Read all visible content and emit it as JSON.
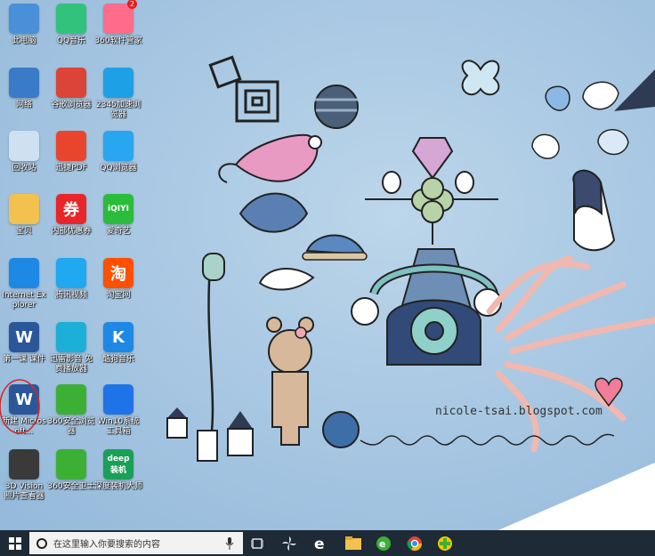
{
  "desktop": {
    "icons": [
      {
        "label": "此电脑",
        "icon": "computer-icon",
        "color": "#4a90d9"
      },
      {
        "label": "QQ音乐",
        "icon": "qq-music-icon",
        "color": "#31c27c"
      },
      {
        "label": "360软件管家",
        "icon": "360-software-manager-icon",
        "color": "#ff6b8a",
        "badge": "2"
      },
      {
        "label": "网络",
        "icon": "network-icon",
        "color": "#3a7bc8"
      },
      {
        "label": "谷歌浏览器",
        "icon": "chrome-icon",
        "color": "#db4437"
      },
      {
        "label": "2345加速浏览器",
        "icon": "ie-browser-icon",
        "color": "#1ea0e6"
      },
      {
        "label": "回收站",
        "icon": "recycle-bin-icon",
        "color": "#cfe0f0"
      },
      {
        "label": "迅捷PDF",
        "icon": "pdf-icon",
        "color": "#e8452c"
      },
      {
        "label": "QQ浏览器",
        "icon": "qq-browser-icon",
        "color": "#2aa5f0"
      },
      {
        "label": "宝贝",
        "icon": "folder-icon",
        "color": "#f2c14e"
      },
      {
        "label": "内部优惠券",
        "icon": "coupon-icon",
        "color": "#e8262a",
        "glyph": "券"
      },
      {
        "label": "爱奇艺",
        "icon": "iqiyi-icon",
        "color": "#2bbc3c",
        "glyph": "iQIYI"
      },
      {
        "label": "Internet Explorer",
        "icon": "internet-explorer-icon",
        "color": "#1e88e5"
      },
      {
        "label": "腾讯视频",
        "icon": "tencent-video-icon",
        "color": "#20a8f0"
      },
      {
        "label": "淘宝网",
        "icon": "taobao-icon",
        "color": "#ff5000",
        "glyph": "淘"
      },
      {
        "label": "第一课 课件",
        "icon": "word-document-icon",
        "color": "#2b579a",
        "glyph": "W"
      },
      {
        "label": "迅雷影音 免费播放器",
        "icon": "thunder-player-icon",
        "color": "#1cb0d8"
      },
      {
        "label": "酷狗音乐",
        "icon": "kugou-icon",
        "color": "#1e88e5",
        "glyph": "K"
      },
      {
        "label": "新建 Microsoft...",
        "icon": "word-document-icon",
        "color": "#2b579a",
        "glyph": "W"
      },
      {
        "label": "360安全浏览器",
        "icon": "360-browser-icon",
        "color": "#3cb035"
      },
      {
        "label": "Win10系统 工具箱",
        "icon": "windows-icon",
        "color": "#1e73e8"
      },
      {
        "label": "3D Vision 照片查看器",
        "icon": "3d-vision-icon",
        "color": "#3a3a3a"
      },
      {
        "label": "360安全卫士",
        "icon": "360-security-icon",
        "color": "#3cb035"
      },
      {
        "label": "深度装机大师",
        "icon": "deepin-install-icon",
        "color": "#18a058",
        "glyph": "deep装机"
      }
    ],
    "watermark": "nicole-tsai.blogspot.com"
  },
  "taskbar": {
    "search_placeholder": "在这里输入你要搜索的内容",
    "pinned": [
      "task-view-icon",
      "windmill-icon",
      "edge-icon",
      "file-explorer-icon",
      "360-browser-icon",
      "chrome-icon",
      "360-security-icon"
    ]
  },
  "colors": {
    "taskbar_bg": "#1e2a36",
    "search_bg": "#f2f2f2",
    "highlight_circle": "#d62828"
  }
}
